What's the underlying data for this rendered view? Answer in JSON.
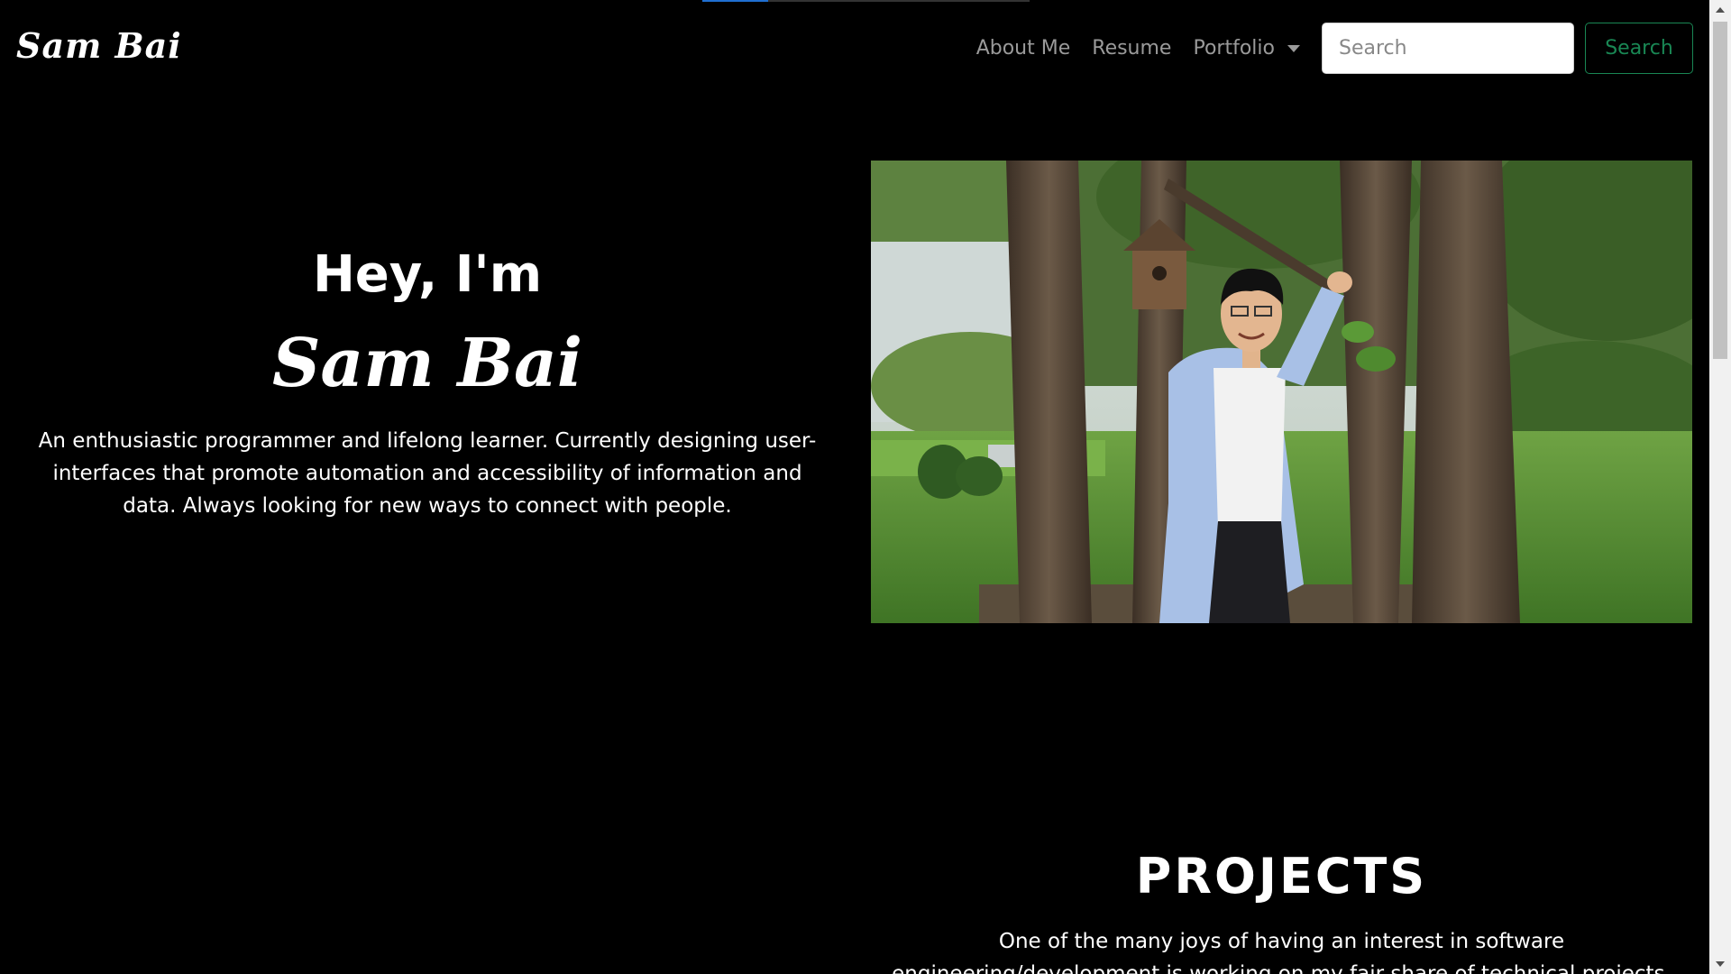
{
  "page_progress": 0.2,
  "navbar": {
    "brand": "Sam Bai",
    "links": [
      {
        "label": "About Me"
      },
      {
        "label": "Resume"
      },
      {
        "label": "Portfolio"
      }
    ],
    "search": {
      "placeholder": "Search",
      "button_label": "Search"
    }
  },
  "hero": {
    "greeting": "Hey, I'm",
    "name": "Sam Bai",
    "description": "An enthusiastic programmer and lifelong learner. Currently designing user-interfaces that promote automation and accessibility of information and data. Always looking for new ways to connect with people.",
    "photo_icon": "portrait-photo"
  },
  "projects": {
    "title": "PROJECTS",
    "description": "One of the many joys of having an interest in software engineering/development is working on my fair share of technical projects. These range from classic"
  },
  "colors": {
    "background": "#000000",
    "nav_link": "#9a9a9a",
    "search_button": "#198754",
    "progress_fill": "#1f6fd1"
  }
}
